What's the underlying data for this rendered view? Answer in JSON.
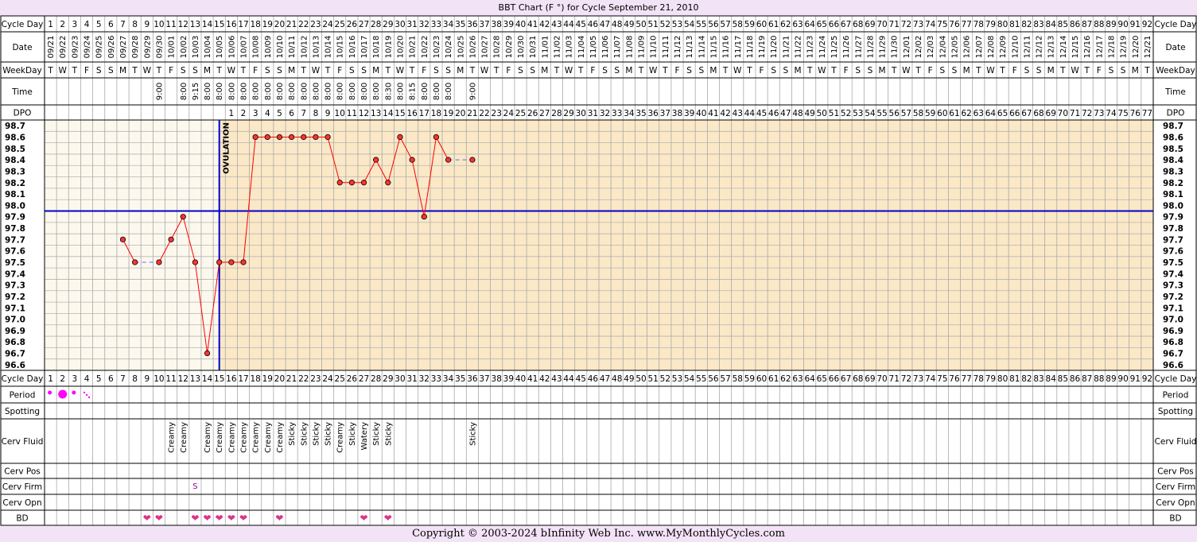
{
  "title": "BBT Chart (F °) for Cycle September 21, 2010",
  "copyright": "Copyright © 2003-2024 bInfinity Web Inc.     www.MyMonthlyCycles.com",
  "row_labels": {
    "cycle_day": "Cycle Day",
    "date": "Date",
    "weekday": "WeekDay",
    "time": "Time",
    "dpo": "DPO",
    "period": "Period",
    "spotting": "Spotting",
    "cerv_fluid": "Cerv Fluid",
    "cerv_pos": "Cerv Pos",
    "cerv_firm": "Cerv Firm",
    "cerv_opn": "Cerv Opn",
    "bd": "BD"
  },
  "ovulation_label": "OVULATION",
  "colors": {
    "background": "#f3e3f7",
    "pre_ovulation": "#fdf8ed",
    "post_ovulation": "#fbe8c6",
    "grid": "#999999",
    "temp_line": "#ff0000",
    "marker_fill": "#ff3333",
    "coverline": "#0000cc",
    "period": "#ff00ff",
    "heart": "#dd3388",
    "cerv_firm": "#990099"
  },
  "chart_data": {
    "type": "line",
    "title": "BBT Chart (F °) for Cycle September 21, 2010",
    "cycle_days": [
      1,
      2,
      3,
      4,
      5,
      6,
      7,
      8,
      9,
      10,
      11,
      12,
      13,
      14,
      15,
      16,
      17,
      18,
      19,
      20,
      21,
      22,
      23,
      24,
      25,
      26,
      27,
      28,
      29,
      30,
      31,
      32,
      33,
      34,
      35,
      36,
      37,
      38,
      39,
      40,
      41,
      42,
      43,
      44,
      45,
      46,
      47,
      48,
      49,
      50,
      51,
      52,
      53,
      54,
      55,
      56,
      57,
      58,
      59,
      60,
      61,
      62,
      63,
      64,
      65,
      66,
      67,
      68,
      69,
      70,
      71,
      72,
      73,
      74,
      75,
      76,
      77,
      78,
      79,
      80,
      81,
      82,
      83,
      84,
      85,
      86,
      87,
      88,
      89,
      90,
      91,
      92
    ],
    "dates": [
      "09/21",
      "09/22",
      "09/23",
      "09/24",
      "09/25",
      "09/26",
      "09/27",
      "09/28",
      "09/29",
      "09/30",
      "10/01",
      "10/02",
      "10/03",
      "10/04",
      "10/05",
      "10/06",
      "10/07",
      "10/08",
      "10/09",
      "10/10",
      "10/11",
      "10/12",
      "10/13",
      "10/14",
      "10/15",
      "10/16",
      "10/17",
      "10/18",
      "10/19",
      "10/20",
      "10/21",
      "10/22",
      "10/23",
      "10/24",
      "10/25",
      "10/26",
      "10/27",
      "10/28",
      "10/29",
      "10/30",
      "10/31",
      "11/01",
      "11/02",
      "11/03",
      "11/04",
      "11/05",
      "11/06",
      "11/07",
      "11/08",
      "11/09",
      "11/10",
      "11/11",
      "11/12",
      "11/13",
      "11/14",
      "11/15",
      "11/16",
      "11/17",
      "11/18",
      "11/19",
      "11/20",
      "11/21",
      "11/22",
      "11/23",
      "11/24",
      "11/25",
      "11/26",
      "11/27",
      "11/28",
      "11/29",
      "11/30",
      "12/01",
      "12/02",
      "12/03",
      "12/04",
      "12/05",
      "12/06",
      "12/07",
      "12/08",
      "12/09",
      "12/10",
      "12/11",
      "12/12",
      "12/13",
      "12/14",
      "12/15",
      "12/16",
      "12/17",
      "12/18",
      "12/19",
      "12/20",
      "12/21"
    ],
    "weekdays": [
      "T",
      "W",
      "T",
      "F",
      "S",
      "S",
      "M",
      "T",
      "W",
      "T",
      "F",
      "S",
      "S",
      "M",
      "T",
      "W",
      "T",
      "F",
      "S",
      "S",
      "M",
      "T",
      "W",
      "T",
      "F",
      "S",
      "S",
      "M",
      "T",
      "W",
      "T",
      "F",
      "S",
      "S",
      "M",
      "T",
      "W",
      "T",
      "F",
      "S",
      "S",
      "M",
      "T",
      "W",
      "T",
      "F",
      "S",
      "S",
      "M",
      "T",
      "W",
      "T",
      "F",
      "S",
      "S",
      "M",
      "T",
      "W",
      "T",
      "F",
      "S",
      "S",
      "M",
      "T",
      "W",
      "T",
      "F",
      "S",
      "S",
      "M",
      "T",
      "W",
      "T",
      "F",
      "S",
      "S",
      "M",
      "T",
      "W",
      "T",
      "F",
      "S",
      "S",
      "M",
      "T",
      "W",
      "T",
      "F",
      "S",
      "S",
      "M",
      "T"
    ],
    "times": {
      "10": "9:00",
      "12": "8:00",
      "13": "9:15",
      "14": "8:00",
      "15": "8:00",
      "16": "8:00",
      "17": "8:00",
      "18": "8:00",
      "19": "8:00",
      "20": "8:00",
      "21": "8:00",
      "22": "8:00",
      "23": "8:00",
      "24": "8:00",
      "25": "8:00",
      "26": "8:00",
      "27": "8:00",
      "28": "8:00",
      "29": "8:30",
      "30": "8:00",
      "31": "8:15",
      "32": "8:00",
      "33": "8:00",
      "34": "8:00",
      "36": "9:00"
    },
    "dpo_start_day": 16,
    "dpo_count": 77,
    "temperatures": {
      "7": 97.7,
      "8": 97.5,
      "10": 97.5,
      "11": 97.7,
      "12": 97.9,
      "13": 97.5,
      "14": 96.7,
      "15": 97.5,
      "16": 97.5,
      "17": 97.5,
      "18": 98.6,
      "19": 98.6,
      "20": 98.6,
      "21": 98.6,
      "22": 98.6,
      "23": 98.6,
      "24": 98.6,
      "25": 98.2,
      "26": 98.2,
      "27": 98.2,
      "28": 98.4,
      "29": 98.2,
      "30": 98.6,
      "31": 98.4,
      "32": 97.9,
      "33": 98.6,
      "34": 98.4,
      "36": 98.4
    },
    "dashed_gaps": [
      [
        8,
        10
      ],
      [
        34,
        36
      ]
    ],
    "y_ticks": [
      "98.7",
      "98.6",
      "98.5",
      "98.4",
      "98.3",
      "98.2",
      "98.1",
      "98.0",
      "97.9",
      "97.8",
      "97.7",
      "97.6",
      "97.5",
      "97.4",
      "97.3",
      "97.2",
      "97.1",
      "97.0",
      "96.9",
      "96.8",
      "96.7",
      "96.6"
    ],
    "ylim": [
      96.6,
      98.7
    ],
    "coverline": 98.0,
    "ovulation_day": 15,
    "period": {
      "1": "light",
      "2": "heavy",
      "3": "light",
      "4": "spotting"
    },
    "cerv_fluid": {
      "11": "Creamy",
      "12": "Creamy",
      "14": "Creamy",
      "15": "Creamy",
      "16": "Creamy",
      "17": "Creamy",
      "18": "Creamy",
      "19": "Creamy",
      "20": "Creamy",
      "21": "Sticky",
      "22": "Sticky",
      "23": "Sticky",
      "24": "Sticky",
      "25": "Creamy",
      "26": "Sticky",
      "27": "Watery",
      "28": "Sticky",
      "29": "Sticky",
      "36": "Sticky"
    },
    "cerv_firm": {
      "13": "S"
    },
    "bd_days": [
      9,
      10,
      13,
      14,
      15,
      16,
      17,
      20,
      27,
      29
    ],
    "bd_symbol": "❤"
  }
}
